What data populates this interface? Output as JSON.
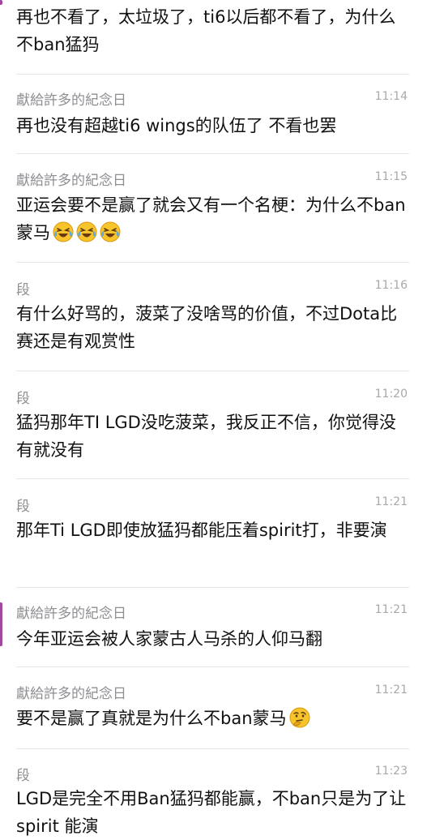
{
  "accent_color": "#a1479f",
  "messages": [
    {
      "sender": "",
      "time": "",
      "text": "再也不看了，太垃圾了，ti6以后都不看了，为什么不ban猛犸",
      "emojis": []
    },
    {
      "sender": "獻給許多的紀念日",
      "time": "11:14",
      "text": "再也没有超越ti6 wings的队伍了 不看也罢",
      "emojis": []
    },
    {
      "sender": "獻給許多的紀念日",
      "time": "11:15",
      "text": "亚运会要不是赢了就会又有一个名梗：为什么不ban蒙马",
      "emojis": [
        "laughing-crying-emoji",
        "laughing-crying-emoji",
        "laughing-crying-emoji"
      ]
    },
    {
      "sender": "段",
      "time": "11:16",
      "text": "有什么好骂的，菠菜了没啥骂的价值，不过Dota比赛还是有观赏性",
      "emojis": []
    },
    {
      "sender": "段",
      "time": "11:20",
      "text": "猛犸那年TI LGD没吃菠菜，我反正不信，你觉得没有就没有",
      "emojis": []
    },
    {
      "sender": "段",
      "time": "11:21",
      "text": "那年Ti LGD即使放猛犸都能压着spirit打，非要演",
      "emojis": []
    },
    {
      "sender": "獻給許多的紀念日",
      "time": "11:21",
      "text": "今年亚运会被人家蒙古人马杀的人仰马翻",
      "emojis": []
    },
    {
      "sender": "獻給許多的紀念日",
      "time": "11:21",
      "text": "要不是赢了真就是为什么不ban蒙马",
      "emojis": [
        "thinking-emoji"
      ]
    },
    {
      "sender": "段",
      "time": "11:23",
      "text": "LGD是完全不用Ban猛犸都能赢，不ban只是为了让spirit 能演",
      "emojis": []
    }
  ]
}
